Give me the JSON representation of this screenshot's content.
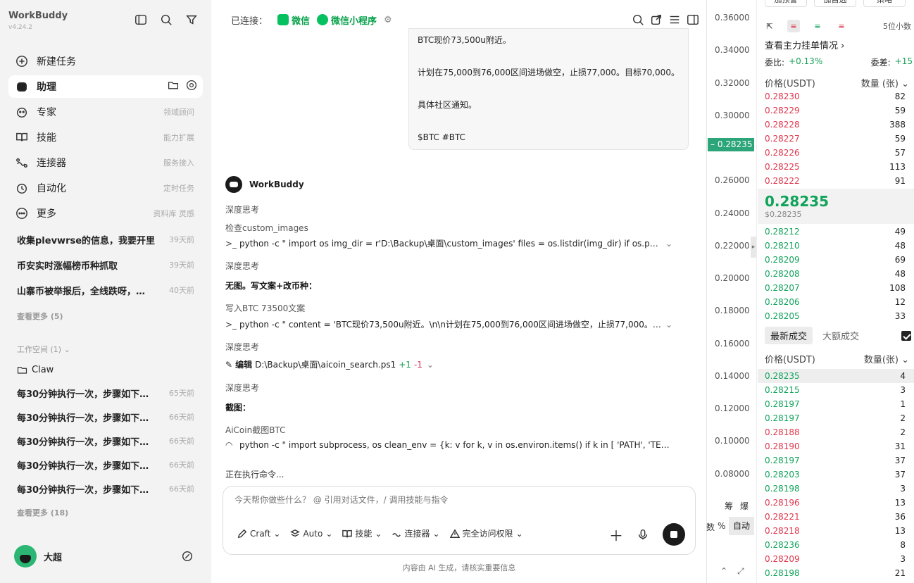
{
  "sidebar": {
    "app_title": "WorkBuddy",
    "version": "v4.24.2",
    "nav": [
      {
        "label": "新建任务",
        "hint": "",
        "icon": "plus-circle-icon"
      },
      {
        "label": "助理",
        "hint": "",
        "icon": "assistant-icon"
      },
      {
        "label": "专家",
        "hint": "领域顾问",
        "icon": "expert-icon"
      },
      {
        "label": "技能",
        "hint": "能力扩展",
        "icon": "book-icon"
      },
      {
        "label": "连接器",
        "hint": "服务接入",
        "icon": "connector-icon"
      },
      {
        "label": "自动化",
        "hint": "定时任务",
        "icon": "alarm-icon"
      },
      {
        "label": "更多",
        "hint": "资料库 灵感",
        "icon": "more-icon"
      }
    ],
    "recent": [
      {
        "title": "收集plevwrse的信息，我要开里",
        "date": "39天前"
      },
      {
        "title": "币安实时涨幅榜币种抓取",
        "date": "39天前"
      },
      {
        "title": "山寨币被举报后，全线跌呀，…",
        "date": "40天前"
      }
    ],
    "see_more_recent": "查看更多 (5)",
    "workspace_label": "工作空间 (1)",
    "folder": "Claw",
    "tasks": [
      {
        "title": "每30分钟执行一次，步骤如下…",
        "date": "65天前"
      },
      {
        "title": "每30分钟执行一次，步骤如下…",
        "date": "66天前"
      },
      {
        "title": "每30分钟执行一次，步骤如下…",
        "date": "66天前"
      },
      {
        "title": "每30分钟执行一次，步骤如下…",
        "date": "66天前"
      },
      {
        "title": "每30分钟执行一次，步骤如下…",
        "date": "66天前"
      }
    ],
    "see_more_tasks": "查看更多 (18)",
    "user_name": "大超"
  },
  "chat": {
    "connected_label": "已连接：",
    "conn_wechat": "微信",
    "conn_miniprogram": "微信小程序",
    "bubble_lines": [
      "BTC现价73,500u附近。",
      "计划在75,000到76,000区间进场做空，止损77,000。目标70,000。",
      "具体社区通知。",
      "$BTC #BTC"
    ],
    "bot_name": "WorkBuddy",
    "think1": "深度思考",
    "step1_title": "检查custom_images",
    "step1_cmd": "python -c \" import os img_dir = r'D:\\Backup\\桌面\\custom_images' files = os.listdir(img_dir) if os.path.e…",
    "think2": "深度思考",
    "text1": "无图。写文案+改币种：",
    "step2_title": "写入BTC 73500文案",
    "step2_cmd": "python -c \" content = 'BTC现价73,500u附近。\\n\\n计划在75,000到76,000区间进场做空，止损77,000。…",
    "think3": "深度思考",
    "edit_label": "编辑",
    "edit_path": "D:\\Backup\\桌面\\aicoin_search.ps1",
    "edit_plus": "+1",
    "edit_minus": "-1",
    "think4": "深度思考",
    "text2": "截图：",
    "step3_title": "AiCoin截图BTC",
    "step3_cmd": "python -c \" import subprocess, os clean_env = {k: v for k, v in os.environ.items() if k in [ 'PATH', 'TEMP', 'TM…",
    "running": "正在执行命令...",
    "composer_placeholder": "今天帮你做些什么？ @ 引用对话文件，/ 调用技能与指令",
    "tools": {
      "craft": "Craft",
      "auto": "Auto",
      "skills": "技能",
      "connectors": "连接器",
      "access": "完全访问权限"
    },
    "footer": "内容由 AI 生成，请核实重要信息"
  },
  "axis": {
    "labels": [
      "0.36000",
      "0.34000",
      "0.32000",
      "0.30000",
      "0.26000",
      "0.24000",
      "0.22000",
      "0.20000",
      "0.18000",
      "0.16000",
      "0.14000",
      "0.12000",
      "0.10000",
      "0.08000"
    ],
    "current": "0.28235",
    "extra1": "筹",
    "extra2": "爆",
    "pct": "%",
    "auto": "自动"
  },
  "book": {
    "top_btns": [
      "加预警",
      "加自选",
      "策略"
    ],
    "decimals": "5位小数",
    "title": "查看主力挂单情况",
    "ratio_label": "委比:",
    "ratio_value": "+0.13%",
    "diff_label": "委差:",
    "diff_value": "+15",
    "price_header": "价格(USDT)",
    "qty_header": "数量 (张)",
    "asks": [
      {
        "p": "0.28230",
        "q": "82"
      },
      {
        "p": "0.28229",
        "q": "59"
      },
      {
        "p": "0.28228",
        "q": "388"
      },
      {
        "p": "0.28227",
        "q": "59"
      },
      {
        "p": "0.28226",
        "q": "57"
      },
      {
        "p": "0.28225",
        "q": "113"
      },
      {
        "p": "0.28222",
        "q": "91"
      }
    ],
    "mid_price": "0.28235",
    "mid_usd": "$0.28235",
    "bids": [
      {
        "p": "0.28212",
        "q": "49"
      },
      {
        "p": "0.28210",
        "q": "48"
      },
      {
        "p": "0.28209",
        "q": "69"
      },
      {
        "p": "0.28208",
        "q": "48"
      },
      {
        "p": "0.28207",
        "q": "108"
      },
      {
        "p": "0.28206",
        "q": "12"
      },
      {
        "p": "0.28205",
        "q": "33"
      }
    ],
    "tab_latest": "最新成交",
    "tab_large": "大额成交",
    "trades_price_header": "价格(USDT)",
    "trades_qty_header": "数量(张)",
    "trades": [
      {
        "p": "0.28235",
        "q": "4",
        "side": "buy"
      },
      {
        "p": "0.28215",
        "q": "3",
        "side": "buy"
      },
      {
        "p": "0.28197",
        "q": "1",
        "side": "buy"
      },
      {
        "p": "0.28197",
        "q": "2",
        "side": "buy"
      },
      {
        "p": "0.28188",
        "q": "2",
        "side": "sell"
      },
      {
        "p": "0.28190",
        "q": "31",
        "side": "sell"
      },
      {
        "p": "0.28197",
        "q": "37",
        "side": "buy"
      },
      {
        "p": "0.28203",
        "q": "37",
        "side": "buy"
      },
      {
        "p": "0.28198",
        "q": "3",
        "side": "buy"
      },
      {
        "p": "0.28196",
        "q": "13",
        "side": "sell"
      },
      {
        "p": "0.28221",
        "q": "36",
        "side": "sell"
      },
      {
        "p": "0.28218",
        "q": "13",
        "side": "sell"
      },
      {
        "p": "0.28236",
        "q": "8",
        "side": "buy"
      },
      {
        "p": "0.28209",
        "q": "3",
        "side": "sell"
      },
      {
        "p": "0.28198",
        "q": "21",
        "side": "buy"
      }
    ]
  }
}
